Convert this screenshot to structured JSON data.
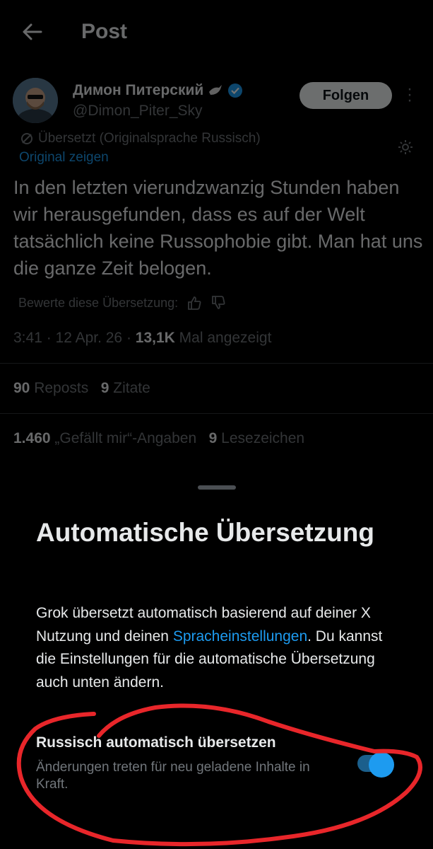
{
  "header": {
    "title": "Post"
  },
  "post": {
    "author_name": "Димон Питерский",
    "handle": "@Dimon_Piter_Sky",
    "follow_label": "Folgen",
    "translated_note": "Übersetzt (Originalsprache Russisch)",
    "show_original": "Original zeigen",
    "text": "In den letzten vierundzwanzig Stunden haben wir herausgefunden, dass es auf der Welt tatsächlich keine Russophobie gibt. Man hat uns die ganze Zeit belogen.",
    "rate_label": "Bewerte diese Übersetzung:",
    "time": "3:41 · 12 Apr. 26 · ",
    "views_count": "13,1K",
    "views_label": " Mal angezeigt",
    "reposts_count": "90",
    "reposts_label": " Reposts",
    "quotes_count": "9",
    "quotes_label": " Zitate",
    "likes_count": "1.460",
    "likes_label": " „Gefällt mir“-Angaben",
    "bookmarks_count": "9",
    "bookmarks_label": " Lesezeichen"
  },
  "sheet": {
    "title": "Automatische Übersetzung",
    "body_1": "Grok übersetzt automatisch basierend auf deiner X Nutzung und deinen ",
    "body_link": "Spracheinstellungen",
    "body_2": ". Du kannst die Einstellungen für die automatische Übersetzung auch unten ändern.",
    "option_title": "Russisch automatisch übersetzen",
    "option_subtitle": "Änderungen treten für neu geladene Inhalte in Kraft.",
    "toggle_on": true
  },
  "colors": {
    "accent": "#1d9bf0",
    "annotation": "#e8262a",
    "background": "#000000"
  }
}
